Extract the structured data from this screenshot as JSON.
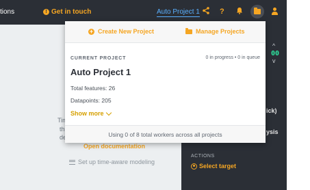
{
  "topbar": {
    "left_fragment": "tions",
    "get_in_touch": "Get in touch",
    "project_name": "Auto Project 1",
    "icons": [
      "share-icon",
      "help-icon",
      "notifications-bell-icon",
      "folder-icon",
      "user-icon"
    ],
    "help_glyph": "?"
  },
  "background": {
    "frag_lines": [
      "Tim",
      "th",
      "de"
    ],
    "open_documentation": "Open documentation",
    "setup_time_aware": "Set up time-aware modeling"
  },
  "right_panel": {
    "frag_ick": "ick)",
    "frag_ysis": "ysis",
    "digits": "00",
    "actions_label": "ACTIONS",
    "select_target": "Select target"
  },
  "dropdown": {
    "create_new_project": "Create New Project",
    "manage_projects": "Manage Projects",
    "current_project_label": "CURRENT PROJECT",
    "status": "0 in progress • 0 in queue",
    "project_name": "Auto Project 1",
    "total_features": "Total features: 26",
    "datapoints": "Datapoints: 205",
    "show_more": "Show more",
    "workers_footer": "Using 0 of 8 total workers across all projects"
  },
  "colors": {
    "accent": "#f5a623",
    "topbar_bg": "#2b2f36",
    "link_blue": "#5ab0ff",
    "digit_green": "#2ee6a0"
  }
}
